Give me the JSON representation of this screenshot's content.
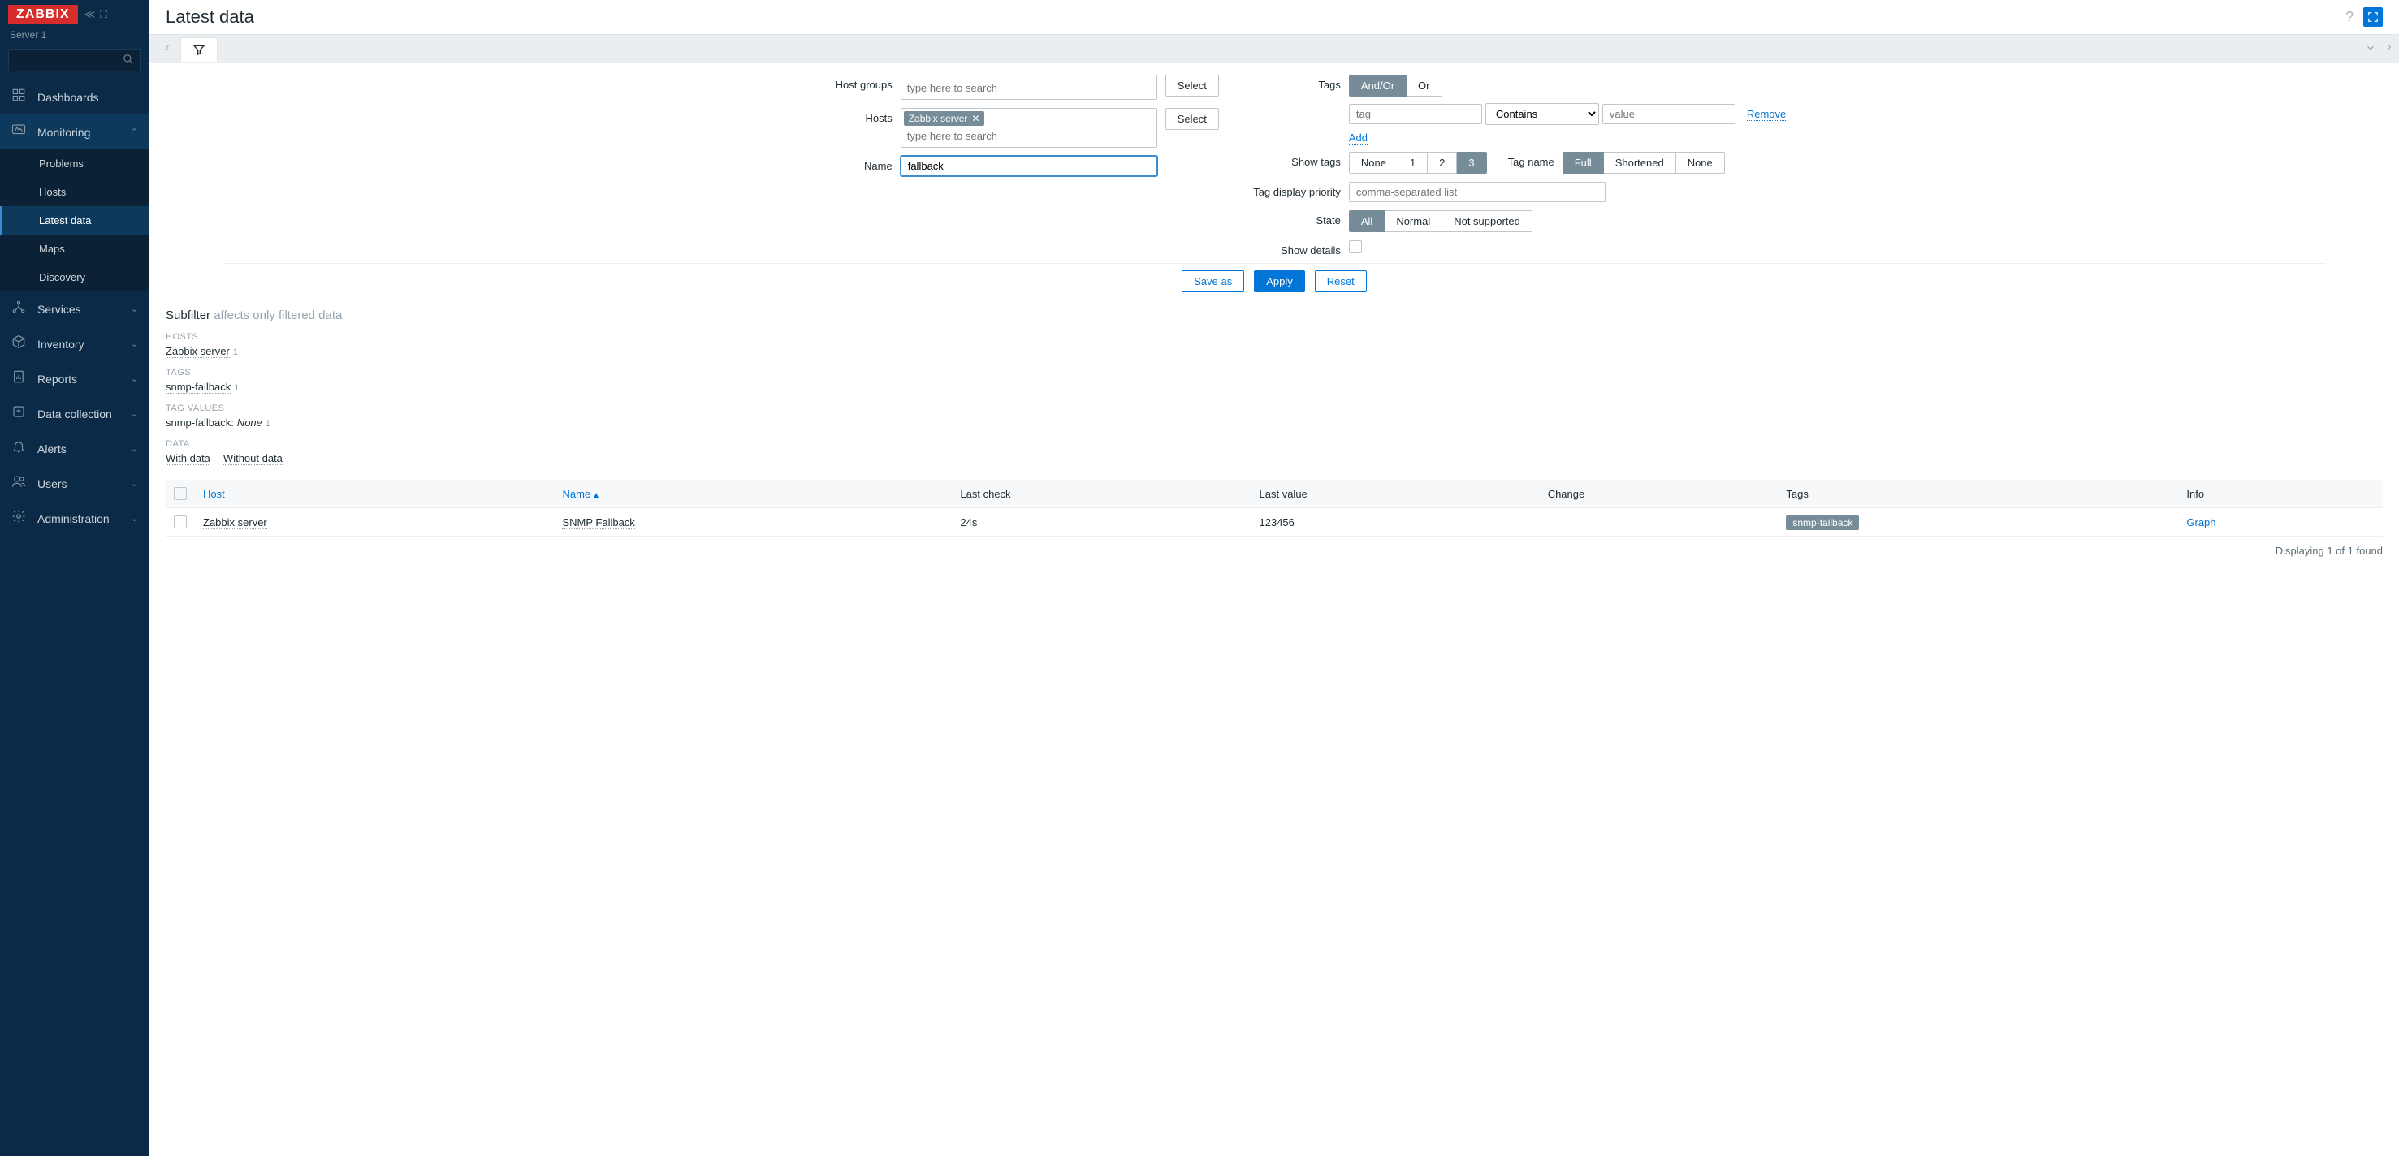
{
  "brand": "ZABBIX",
  "server_name": "Server 1",
  "page_title": "Latest data",
  "sidebar": {
    "items": [
      {
        "icon": "⊞",
        "label": "Dashboards",
        "expandable": false
      },
      {
        "icon": "◉",
        "label": "Monitoring",
        "expandable": true,
        "expanded": true,
        "active_section": true,
        "children": [
          {
            "label": "Problems"
          },
          {
            "label": "Hosts"
          },
          {
            "label": "Latest data",
            "active": true
          },
          {
            "label": "Maps"
          },
          {
            "label": "Discovery"
          }
        ]
      },
      {
        "icon": "⚙",
        "label": "Services",
        "expandable": true
      },
      {
        "icon": "⬡",
        "label": "Inventory",
        "expandable": true
      },
      {
        "icon": "⎘",
        "label": "Reports",
        "expandable": true
      },
      {
        "icon": "⬇",
        "label": "Data collection",
        "expandable": true
      },
      {
        "icon": "🔔",
        "label": "Alerts",
        "expandable": true
      },
      {
        "icon": "👥",
        "label": "Users",
        "expandable": true
      },
      {
        "icon": "⚙",
        "label": "Administration",
        "expandable": true
      }
    ]
  },
  "filter": {
    "labels": {
      "host_groups": "Host groups",
      "hosts": "Hosts",
      "name": "Name",
      "tags": "Tags",
      "show_tags": "Show tags",
      "tag_name": "Tag name",
      "tag_display_priority": "Tag display priority",
      "state": "State",
      "show_details": "Show details"
    },
    "host_groups_placeholder": "type here to search",
    "hosts_chip": "Zabbix server",
    "hosts_placeholder": "type here to search",
    "name_value": "fallback",
    "select_btn": "Select",
    "tags_mode": {
      "andor": "And/Or",
      "or": "Or",
      "active": "And/Or"
    },
    "tag_row": {
      "tag_placeholder": "tag",
      "operator": "Contains",
      "value_placeholder": "value",
      "remove": "Remove"
    },
    "add_link": "Add",
    "show_tags_opts": [
      "None",
      "1",
      "2",
      "3"
    ],
    "show_tags_active": "3",
    "tag_name_opts": [
      "Full",
      "Shortened",
      "None"
    ],
    "tag_name_active": "Full",
    "tag_display_placeholder": "comma-separated list",
    "state_opts": [
      "All",
      "Normal",
      "Not supported"
    ],
    "state_active": "All",
    "actions": {
      "save_as": "Save as",
      "apply": "Apply",
      "reset": "Reset"
    }
  },
  "subfilter": {
    "title": "Subfilter",
    "subtitle": "affects only filtered data",
    "sections": {
      "hosts": {
        "label": "HOSTS",
        "items": [
          {
            "name": "Zabbix server",
            "count": "1"
          }
        ]
      },
      "tags": {
        "label": "TAGS",
        "items": [
          {
            "name": "snmp-fallback",
            "count": "1"
          }
        ]
      },
      "tag_values": {
        "label": "TAG VALUES",
        "items": [
          {
            "prefix": "snmp-fallback:",
            "name": "None",
            "count": "1"
          }
        ]
      },
      "data": {
        "label": "DATA",
        "links": [
          "With data",
          "Without data"
        ]
      }
    }
  },
  "table": {
    "headers": {
      "host": "Host",
      "name": "Name",
      "last_check": "Last check",
      "last_value": "Last value",
      "change": "Change",
      "tags": "Tags",
      "info": "Info"
    },
    "rows": [
      {
        "host": "Zabbix server",
        "name": "SNMP Fallback",
        "last_check": "24s",
        "last_value": "123456",
        "change": "",
        "tags": [
          "snmp-fallback"
        ],
        "action": "Graph"
      }
    ]
  },
  "footer": "Displaying 1 of 1 found"
}
